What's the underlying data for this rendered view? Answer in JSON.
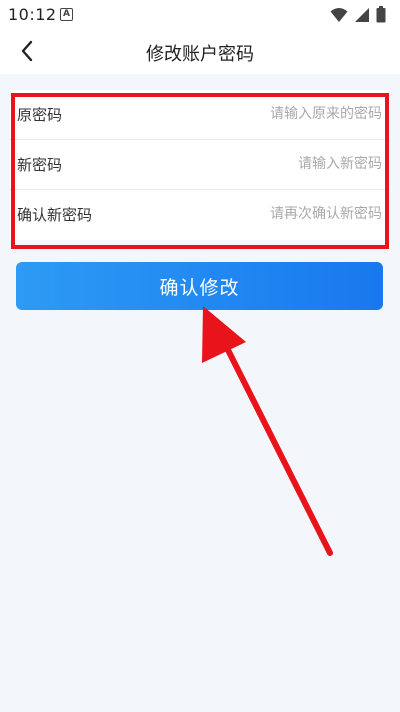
{
  "status_bar": {
    "time": "10:12",
    "notification_glyph": "A",
    "icons": [
      "wifi-icon",
      "signal-icon",
      "battery-icon"
    ]
  },
  "header": {
    "title": "修改账户密码",
    "back_icon": "chevron-left-icon"
  },
  "form": {
    "fields": [
      {
        "label": "原密码",
        "placeholder": "请输入原来的密码",
        "value": ""
      },
      {
        "label": "新密码",
        "placeholder": "请输入新密码",
        "value": ""
      },
      {
        "label": "确认新密码",
        "placeholder": "请再次确认新密码",
        "value": ""
      }
    ]
  },
  "actions": {
    "confirm_label": "确认修改"
  },
  "colors": {
    "background": "#f3f6fa",
    "button_start": "#2d9bf5",
    "button_end": "#1878ee",
    "annotation_red": "#e8131b"
  }
}
